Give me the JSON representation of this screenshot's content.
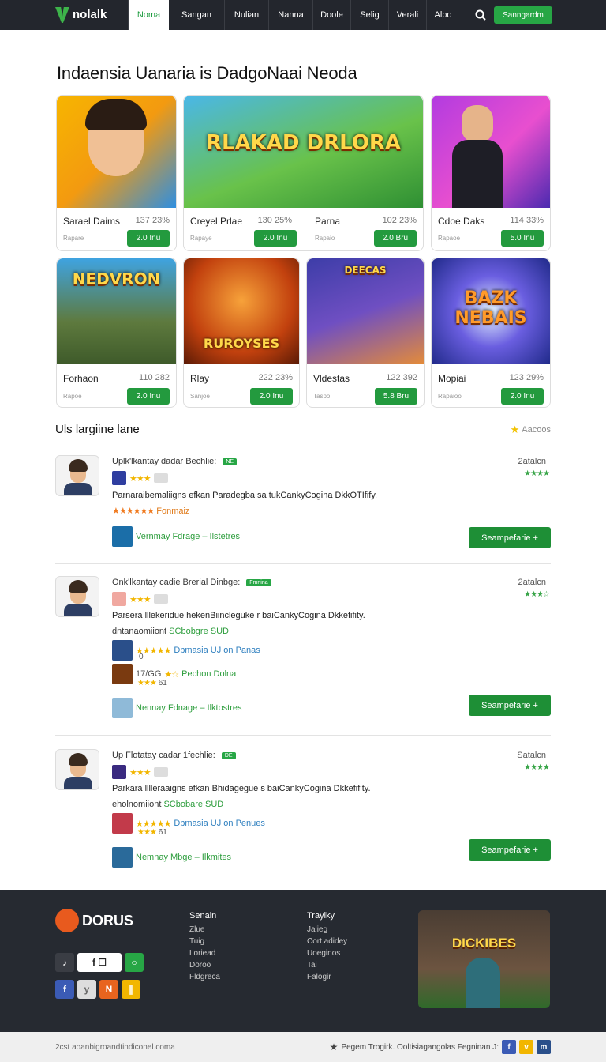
{
  "brand": {
    "name": "nolalk"
  },
  "nav": {
    "items": [
      "Noma",
      "Sangan",
      "Nulian",
      "Nanna",
      "Doole",
      "Selig",
      "Verali",
      "Alpo"
    ],
    "cta": "Sanngardm"
  },
  "hero": {
    "title": "Indaensia Uanaria is DadgoNaai Neoda"
  },
  "cards": [
    {
      "name": "Sarael Daims",
      "num": "137 23%",
      "sub": "Rapare",
      "btn": "2.0 Inu"
    },
    {
      "name": "Creyel Prlae",
      "num": "130 25%",
      "sub": "Rapaye",
      "btn": "2.0 Inu",
      "art": "RLAKAD DRLORA"
    },
    {
      "name": "Parna",
      "num": "102 23%",
      "sub": "Rapaio",
      "btn": "2.0 Bru"
    },
    {
      "name": "Cdoe Daks",
      "num": "114 33%",
      "sub": "Rapaoe",
      "btn": "5.0 Inu"
    },
    {
      "name": "Forhaon",
      "num": "110 282",
      "sub": "Rapoe",
      "btn": "2.0 Inu",
      "art": "NEDVRON"
    },
    {
      "name": "Rlay",
      "num": "222 23%",
      "sub": "Sanjoe",
      "btn": "2.0 Inu",
      "art": "RUROYSES"
    },
    {
      "name": "Vldestas",
      "num": "122 392",
      "sub": "Taspo",
      "btn": "5.8 Bru",
      "art": "DEECAS"
    },
    {
      "name": "Mopiai",
      "num": "123 29%",
      "sub": "Rapaioo",
      "btn": "2.0 Inu",
      "art": "BAZK NEBAIS"
    }
  ],
  "reviews_section": {
    "title": "Uls largiine lane",
    "link": "Aacoos"
  },
  "reviews": [
    {
      "title": "Uplk'lkantay dadar Bechlie:",
      "badge": "NE",
      "date": "2atalcn",
      "body": "Parnaraibemaliigns efkan Paradegba sa tukCankyCogina DkkOTIfify.",
      "rating_link": "Fonmaiz",
      "sub_link": "Vernmay Fdrage – Ilstetres",
      "button": "Seampefarie +"
    },
    {
      "title": "Onk'lkantay cadie Brerial Dinbge:",
      "badge": "Fmnina",
      "date": "2atalcn",
      "body": "Parsera lllekeridue hekenBiincleguke r baiCankyCogina Dkkefifity.",
      "extra_line": "dntanaomiiont",
      "extra_link": "SCbobgre SUD",
      "link_a": "Dbmasia UJ on Panas",
      "small_a": "0",
      "small_b": "17/GG",
      "link_b": "Pechon Dolna",
      "count": "61",
      "sub_link": "Nennay Fdnage – Ilktostres",
      "button": "Seampefarie +"
    },
    {
      "title": "Up Flotatay cadar 1fechlie:",
      "badge": "DE",
      "date": "Satalcn",
      "body": "Parkara lllleraaigns efkan Bhidagegue s baiCankyCogina Dkkefifity.",
      "extra_line": "eholnomiiont",
      "extra_link": "SCbobare SUD",
      "link_a": "Dbmasia UJ on Penues",
      "count": "61",
      "sub_link": "Nemnay Mbge – Ilkmites",
      "button": "Seampefarie +"
    }
  ],
  "footer": {
    "logo": "DORUS",
    "col1": {
      "head": "Senain",
      "items": [
        "Zlue",
        "Tuig",
        "Loriead",
        "Doroo",
        "Fldgreca"
      ]
    },
    "col2": {
      "head": "Traylky",
      "items": [
        "Jalieg",
        "Cort.adidey",
        "Uoeginos",
        "Tai",
        "Falogir"
      ]
    },
    "promo": "DICKIBES"
  },
  "bottom": {
    "left": "2cst aoanbigroandtindiconel.coma",
    "right": "Pegem Trogirk. Ooltisiagangolas Fegninan J:"
  },
  "colors": {
    "accent": "#27a645",
    "dark": "#23262d"
  }
}
